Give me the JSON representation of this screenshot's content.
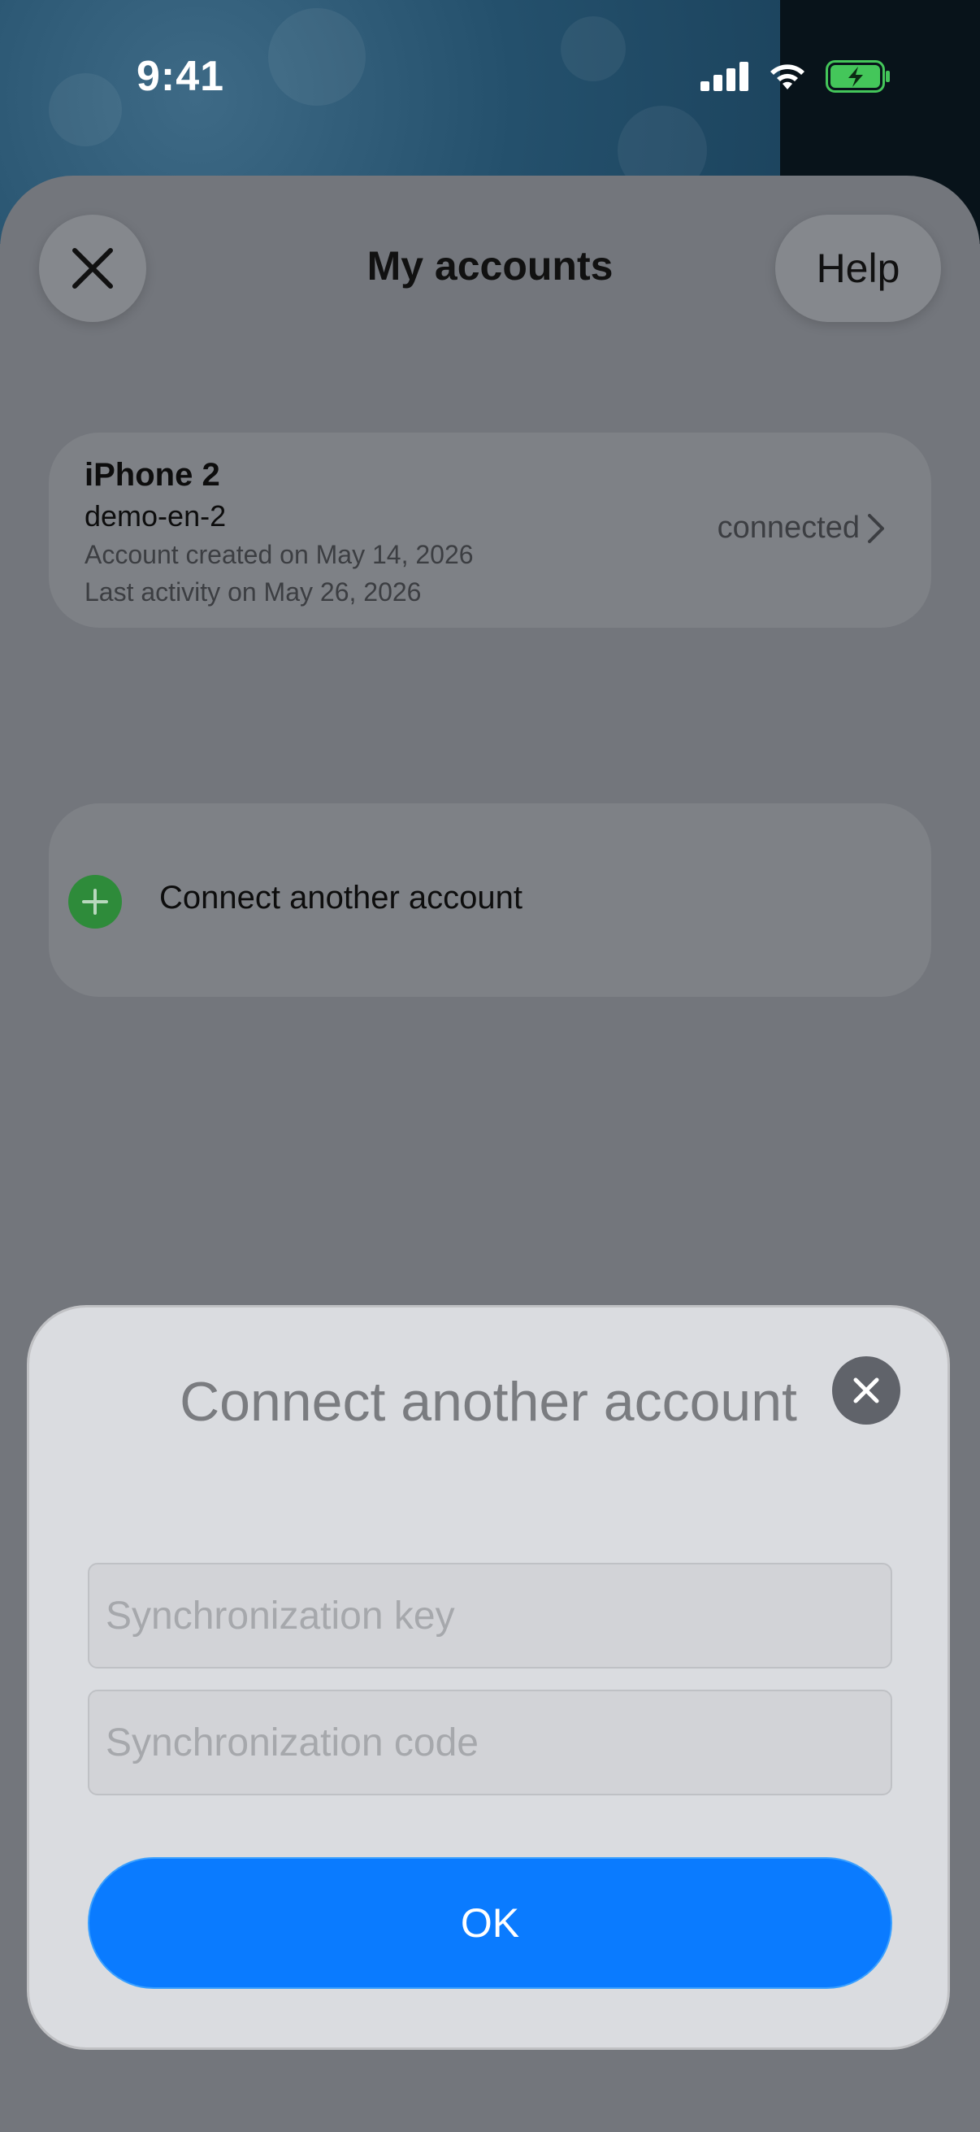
{
  "status_bar": {
    "time": "9:41",
    "icons": [
      "cellular-icon",
      "wifi-icon",
      "battery-charging-icon"
    ]
  },
  "header": {
    "title": "My accounts",
    "close_icon": "close-icon",
    "help_label": "Help"
  },
  "account": {
    "name": "iPhone 2",
    "username": "demo-en-2",
    "created": "Account created on May 14, 2026",
    "last_activity": "Last activity on May 26, 2026",
    "status": "connected"
  },
  "connect_row": {
    "label": "Connect another account",
    "icon": "plus-icon",
    "icon_color": "#2e8b3a"
  },
  "modal": {
    "title": "Connect another account",
    "close_icon": "close-icon",
    "key_placeholder": "Synchronization key",
    "key_value": "",
    "code_placeholder": "Synchronization code",
    "code_value": "",
    "ok_label": "OK",
    "ok_color": "#0a7bff"
  }
}
